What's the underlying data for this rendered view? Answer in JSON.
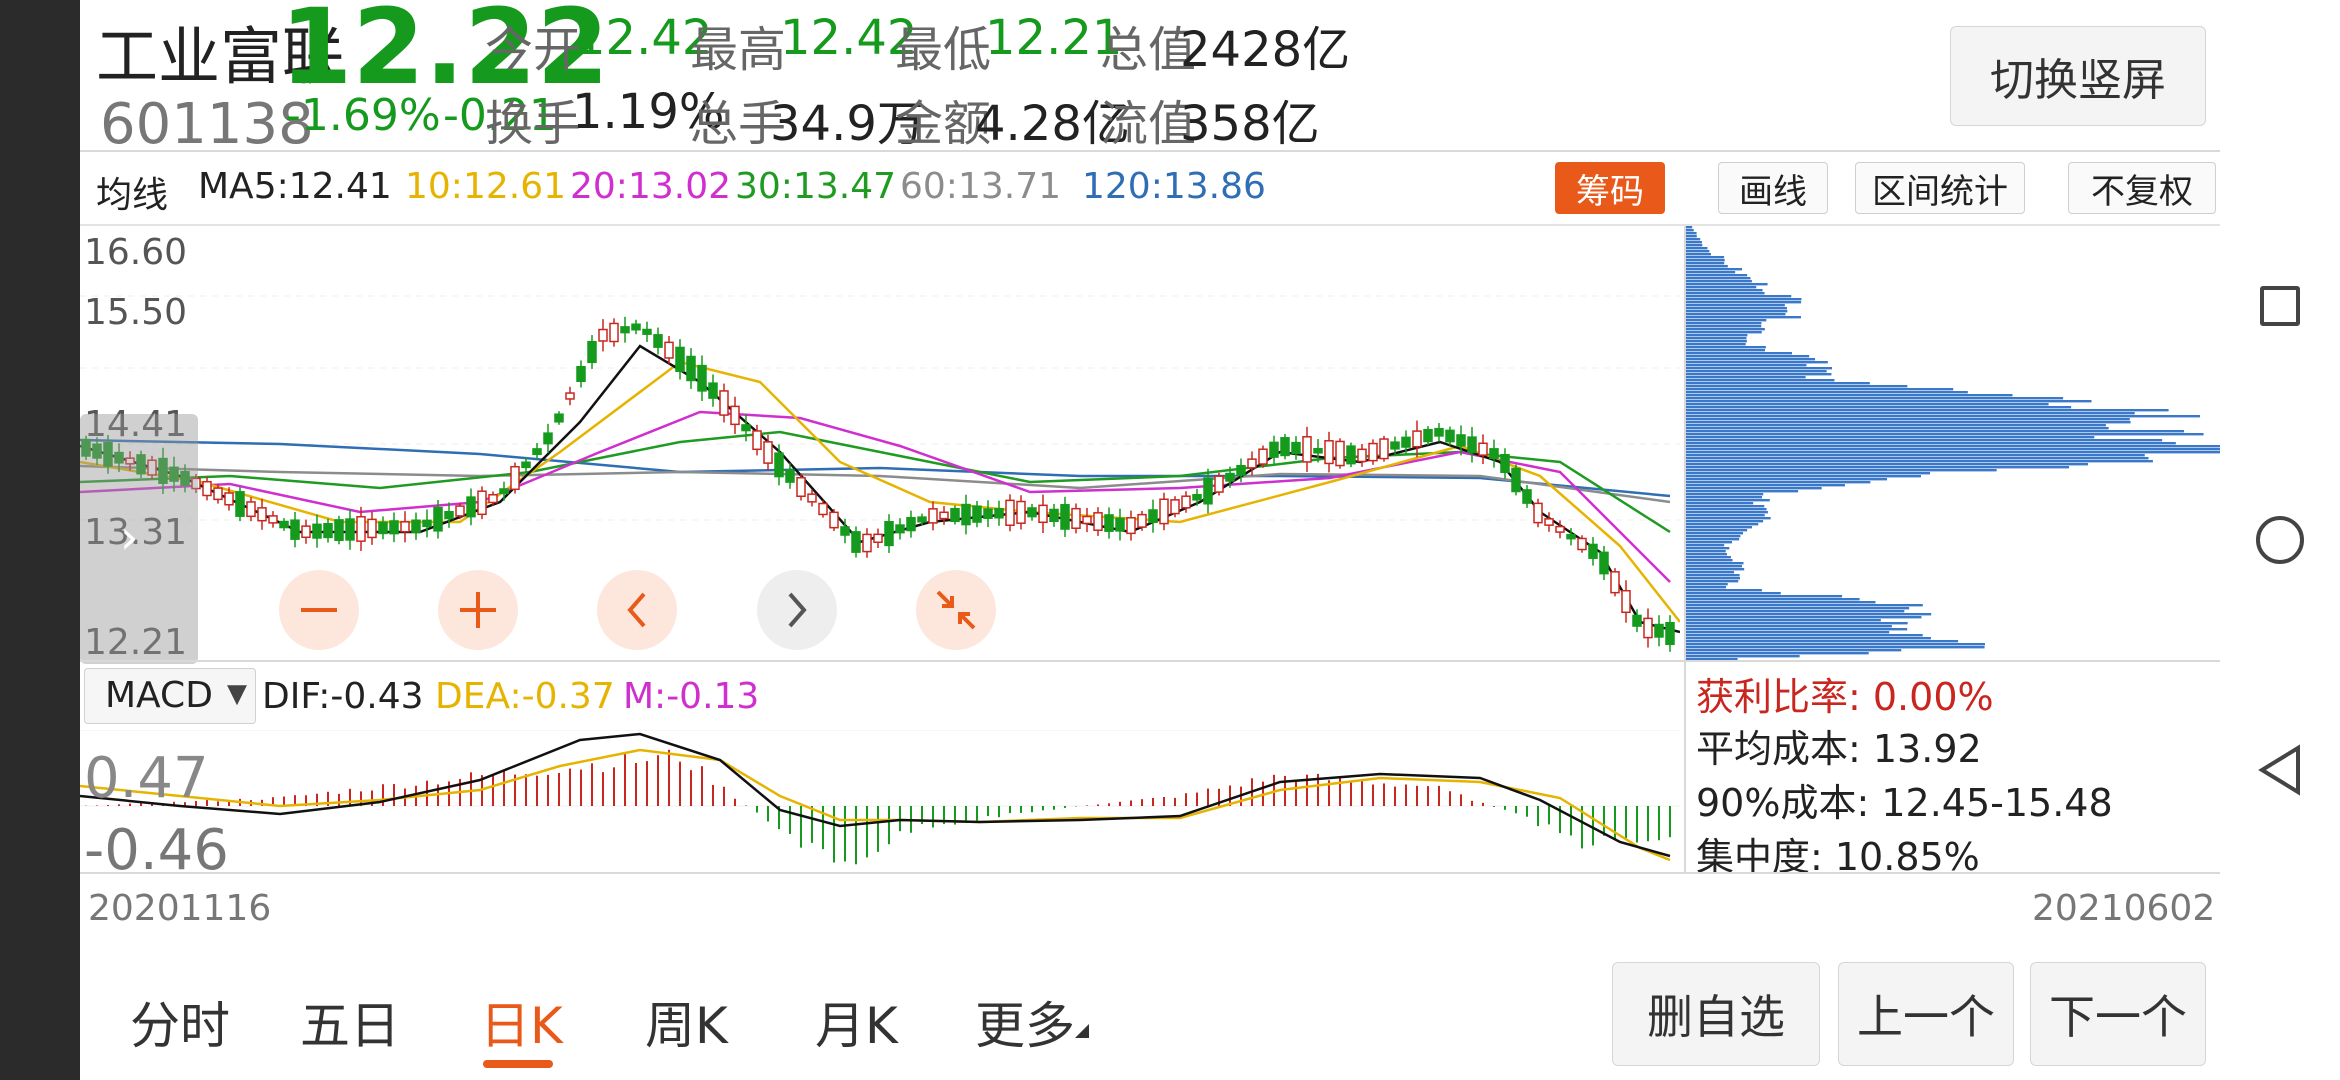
{
  "stock": {
    "name": "工业富联",
    "code": "601138",
    "price": "12.22",
    "change_pct": "-1.69%",
    "change_abs": "-0.21",
    "open_label": "今开",
    "open": "12.42",
    "high_label": "最高",
    "high": "12.42",
    "low_label": "最低",
    "low": "12.21",
    "mcap_label": "总值",
    "mcap": "2428亿",
    "turnover_label": "换手",
    "turnover": "1.19%",
    "volume_label": "总手",
    "volume": "34.9万",
    "amount_label": "金额",
    "amount": "4.28亿",
    "float_label": "流值",
    "float": "358亿",
    "switch_label": "切换竖屏"
  },
  "ma_bar": {
    "label": "均线",
    "ma5": "MA5:12.41",
    "ma10": "10:12.61",
    "ma20": "20:13.02",
    "ma30": "30:13.47",
    "ma60": "60:13.71",
    "ma120": "120:13.86",
    "chip_btn": "筹码",
    "draw_btn": "画线",
    "range_btn": "区间统计",
    "adjust_btn": "不复权"
  },
  "price_axis": [
    "16.60",
    "15.50",
    "14.41",
    "13.31",
    "12.21"
  ],
  "macd": {
    "selector": "MACD",
    "dif": "DIF:-0.43",
    "dea": "DEA:-0.37",
    "m": "M:-0.13",
    "axis_top": "0.47",
    "axis_bottom": "-0.46"
  },
  "chip_stats": {
    "profit": "获利比率: 0.00%",
    "avg_cost": "平均成本: 13.92",
    "cost90": "90%成本:  12.45-15.48",
    "concentration": "集中度: 10.85%"
  },
  "dates": {
    "start": "20201116",
    "end": "20210602"
  },
  "tabs": [
    "分时",
    "五日",
    "日K",
    "周K",
    "月K",
    "更多"
  ],
  "active_tab": "日K",
  "bottom_buttons": {
    "remove": "删自选",
    "prev": "上一个",
    "next": "下一个"
  },
  "colors": {
    "up": "#c8261e",
    "down": "#159a1d",
    "accent": "#e8591a",
    "chip_blue": "#3a78c9",
    "ma5": "#111111",
    "ma10": "#e6b400",
    "ma20": "#d02fd0",
    "ma30": "#1f9b22",
    "ma60": "#8c8c8c",
    "ma120": "#2f6db5"
  }
}
